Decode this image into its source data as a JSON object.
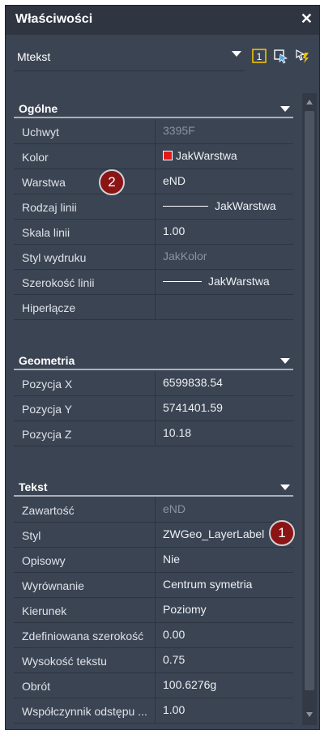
{
  "panel": {
    "title": "Właściwości"
  },
  "selector": {
    "value": "Mtekst"
  },
  "sections": {
    "general": {
      "title": "Ogólne",
      "rows": [
        {
          "name": "Uchwyt",
          "value": "3395F"
        },
        {
          "name": "Kolor",
          "value": "JakWarstwa"
        },
        {
          "name": "Warstwa",
          "value": "eND"
        },
        {
          "name": "Rodzaj linii",
          "value": "JakWarstwa"
        },
        {
          "name": "Skala linii",
          "value": "1.00"
        },
        {
          "name": "Styl wydruku",
          "value": "JakKolor"
        },
        {
          "name": "Szerokość linii",
          "value": "JakWarstwa"
        },
        {
          "name": "Hiperłącze",
          "value": ""
        }
      ]
    },
    "geometry": {
      "title": "Geometria",
      "rows": [
        {
          "name": "Pozycja X",
          "value": "6599838.54"
        },
        {
          "name": "Pozycja Y",
          "value": "5741401.59"
        },
        {
          "name": "Pozycja Z",
          "value": "10.18"
        }
      ]
    },
    "text": {
      "title": "Tekst",
      "rows": [
        {
          "name": "Zawartość",
          "value": "eND"
        },
        {
          "name": "Styl",
          "value": "ZWGeo_LayerLabel"
        },
        {
          "name": "Opisowy",
          "value": "Nie"
        },
        {
          "name": "Wyrównanie",
          "value": "Centrum symetria"
        },
        {
          "name": "Kierunek",
          "value": "Poziomy"
        },
        {
          "name": "Zdefiniowana szerokość",
          "value": "0.00"
        },
        {
          "name": "Wysokość tekstu",
          "value": "0.75"
        },
        {
          "name": "Obrót",
          "value": "100.6276g"
        },
        {
          "name": "Współczynnik odstępu ...",
          "value": "1.00"
        }
      ]
    }
  },
  "badges": {
    "one": "1",
    "two": "2"
  },
  "colors": {
    "accent_badge": "#8b1414",
    "color_swatch": "#e11a1a",
    "panel_bg": "#3b4453"
  },
  "icons": [
    "close-icon",
    "chevron-down-icon",
    "toggle-pickadd-icon",
    "quick-select-icon",
    "select-objects-icon"
  ]
}
